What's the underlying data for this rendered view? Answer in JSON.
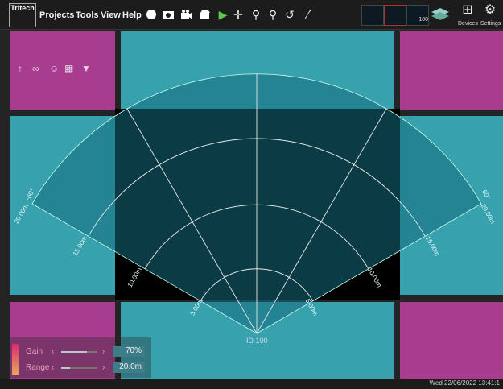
{
  "brand": {
    "name": "Tritech"
  },
  "menu": {
    "items": [
      "Projects",
      "Tools",
      "View",
      "Help"
    ]
  },
  "toolbar": {
    "icons": [
      "record-icon",
      "camera-icon",
      "video-icon",
      "playback-icon",
      "cursor-icon",
      "pan-icon",
      "zoom-in-icon",
      "zoom-out-icon",
      "reset-view-icon",
      "measure-icon"
    ],
    "devices_label": "Devices",
    "settings_label": "Settings",
    "thumb_scale": "100"
  },
  "panel_tools": [
    "signal-icon",
    "antenna-icon",
    "person-icon",
    "grid-icon",
    "filter-icon"
  ],
  "sonar": {
    "id_label": "ID 100",
    "ranges": [
      "5.00m",
      "10.00m",
      "15.00m",
      "20.00m"
    ],
    "angles": [
      "-60°",
      "60°"
    ],
    "colors": {
      "sector": "#1f7e8a",
      "arcs": "#dddddd",
      "image": "#000000"
    }
  },
  "controls": {
    "gain": {
      "label": "Gain",
      "value": "70%",
      "level": 0.7
    },
    "range": {
      "label": "Range",
      "value": "20.0m",
      "level": 0.25
    }
  },
  "status": {
    "datetime": "Wed 22/06/2022 13:41:1"
  }
}
